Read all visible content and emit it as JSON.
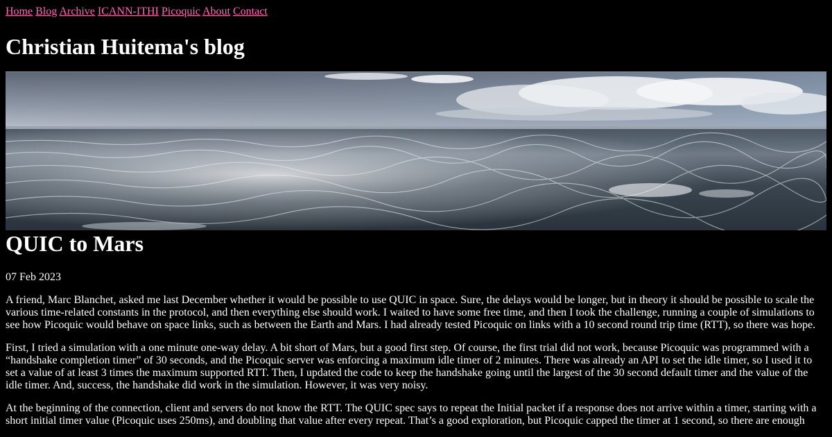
{
  "nav": {
    "items": [
      "Home",
      "Blog",
      "Archive",
      "ICANN-ITHI",
      "Picoquic",
      "About",
      "Contact"
    ]
  },
  "blog_title": "Christian Huitema's blog",
  "post": {
    "title": "QUIC to Mars",
    "date": "07 Feb 2023",
    "paragraphs": [
      "A friend, Marc Blanchet, asked me last December whether it would be possible to use QUIC in space. Sure, the delays would be longer, but in theory it should be possible to scale the various time-related constants in the protocol, and then everything else should work. I waited to have some free time, and then I took the challenge, running a couple of simulations to see how Picoquic would behave on space links, such as between the Earth and Mars. I had already tested Picoquic on links with a 10 second round trip time (RTT), so there was hope.",
      "First, I tried a simulation with a one minute one-way delay. A bit short of Mars, but a good first step. Of course, the first trial did not work, because Picoquic was programmed with a “handshake completion timer” of 30 seconds, and the Picoquic server was enforcing a maximum idle timer of 2 minutes. There was already an API to set the idle timer, so I used it to set a value of at least 3 times the maximum supported RTT. Then, I updated the code to keep the handshake going until the largest of the 30 second default timer and the value of the idle timer. And, success, the handshake did work in the simulation. However, it was very noisy.",
      "At the beginning of the connection, client and servers do not know the RTT. The QUIC spec says to repeat the Initial packet if a response does not arrive within a timer, starting with a short initial timer value (Picoquic uses 250ms), and doubling that value after every repeat. That’s a good exploration, but Picoquic capped the timer at 1 second, so there are enough"
    ]
  },
  "colors": {
    "background": "#000000",
    "text": "#ffffff",
    "link": "#ff69b4"
  }
}
